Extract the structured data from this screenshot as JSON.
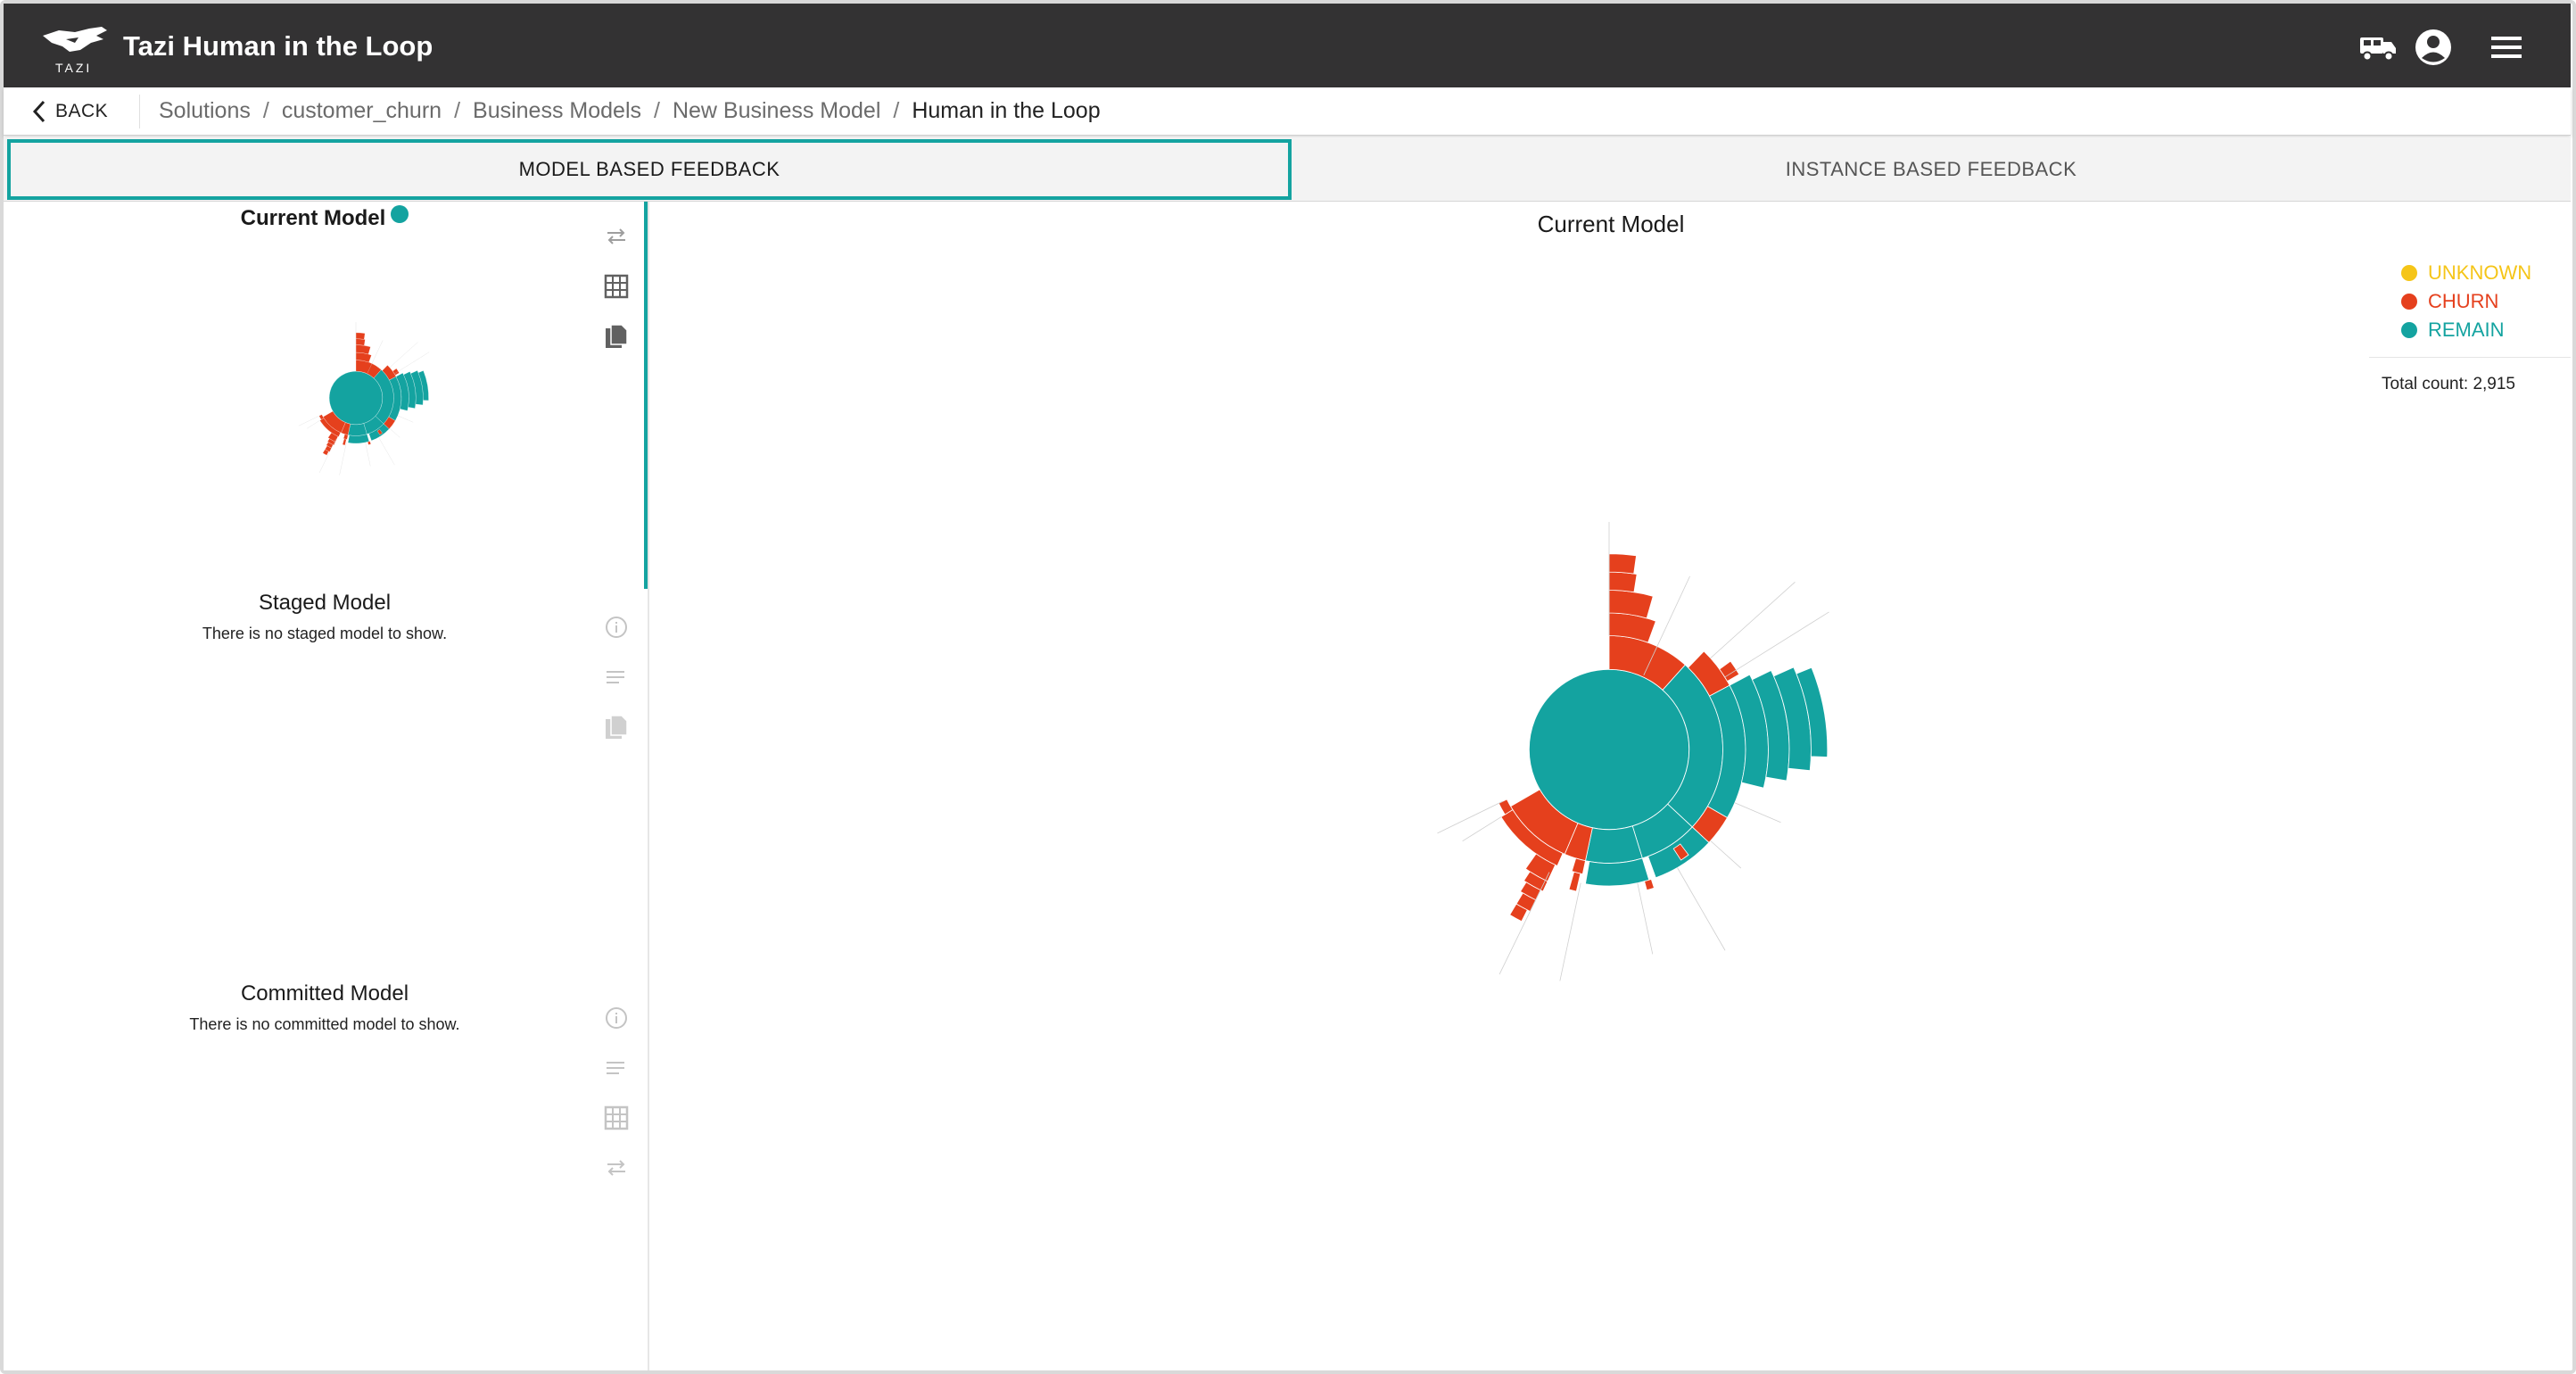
{
  "app": {
    "title": "Tazi Human in the Loop",
    "logo_text": "TAZI"
  },
  "breadcrumb": {
    "back_label": "BACK",
    "items": [
      "Solutions",
      "customer_churn",
      "Business Models",
      "New Business Model",
      "Human in the Loop"
    ],
    "separator": "/"
  },
  "tabs": {
    "model_based": "MODEL BASED FEEDBACK",
    "instance_based": "INSTANCE BASED FEEDBACK",
    "active": "model_based"
  },
  "left_panel": {
    "current": {
      "title": "Current Model"
    },
    "staged": {
      "title": "Staged Model",
      "message": "There is no staged model to show."
    },
    "committed": {
      "title": "Committed Model",
      "message": "There is no committed model to show."
    }
  },
  "main": {
    "chart_title": "Current Model",
    "legend": [
      {
        "label": "UNKNOWN",
        "color": "#f5c518"
      },
      {
        "label": "CHURN",
        "color": "#e5401d"
      },
      {
        "label": "REMAIN",
        "color": "#14a3a0"
      }
    ],
    "total_count": "Total count: 2,915"
  },
  "colors": {
    "accent": "#14a3a0",
    "churn": "#e5401d",
    "remain": "#14a3a0",
    "unknown": "#f5c518",
    "appbar": "#333233"
  }
}
